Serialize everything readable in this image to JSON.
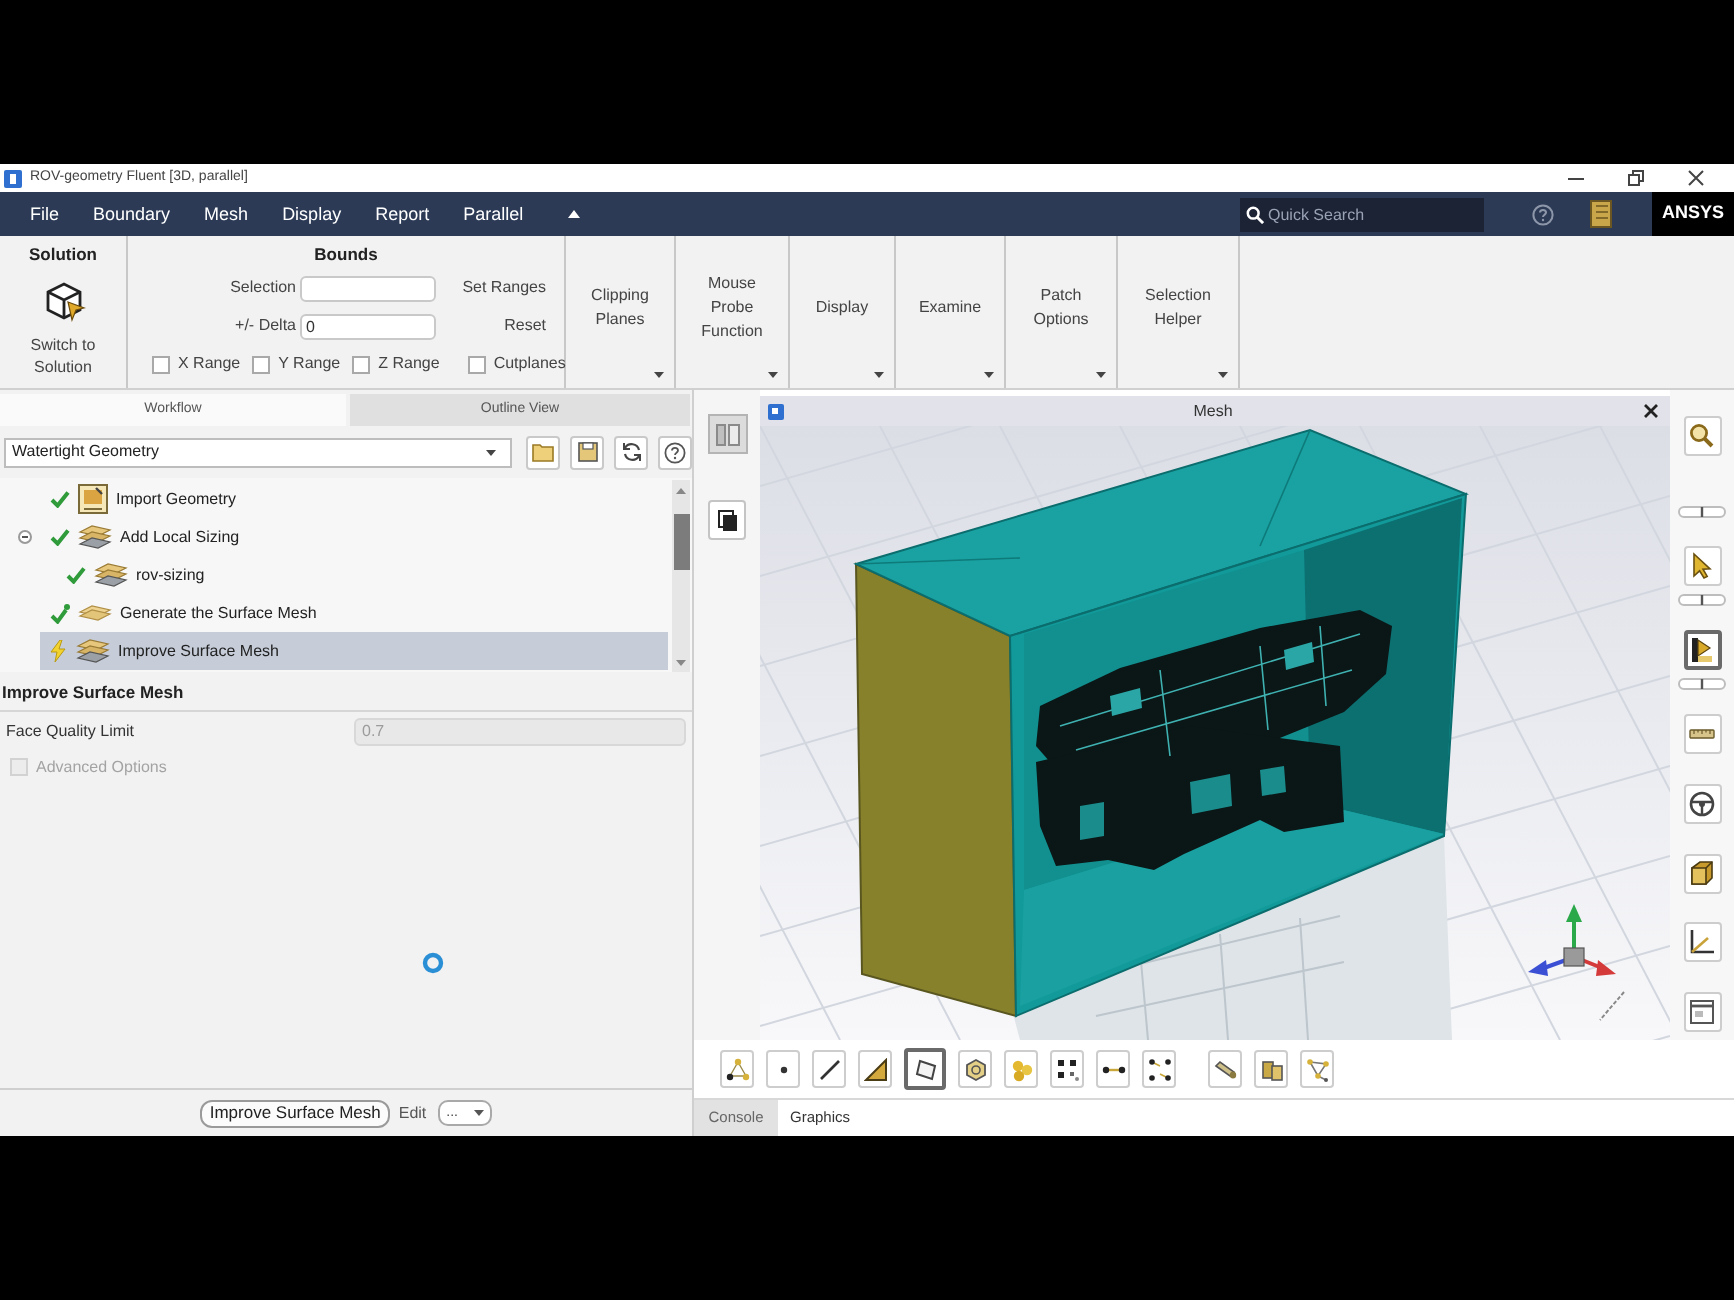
{
  "window": {
    "title": "ROV-geometry Fluent [3D, parallel]"
  },
  "menu_bar": {
    "items": [
      "File",
      "Boundary",
      "Mesh",
      "Display",
      "Report",
      "Parallel"
    ],
    "search": {
      "placeholder": "Quick Search"
    },
    "logo": "ANSYS"
  },
  "ribbon": {
    "solution": {
      "title": "Solution",
      "button": "Switch to Solution"
    },
    "bounds": {
      "title": "Bounds",
      "fields": [
        {
          "label": "Selection"
        },
        {
          "label": "+/- Delta",
          "value": "0"
        }
      ],
      "buttons": [
        "Set Ranges",
        "Reset"
      ],
      "checkboxes": [
        {
          "label": "X Range",
          "checked": false
        },
        {
          "label": "Y Range",
          "checked": false
        },
        {
          "label": "Z Range",
          "checked": false
        },
        {
          "label": "Cutplanes",
          "checked": false
        }
      ]
    },
    "menus": [
      "Clipping Planes",
      "Mouse Probe Function",
      "Display",
      "Examine",
      "Patch Options",
      "Selection Helper"
    ]
  },
  "workflow_panel": {
    "tabs": [
      {
        "label": "Workflow",
        "selected": true
      },
      {
        "label": "Outline View",
        "selected": false
      }
    ],
    "workflow": "Watertight Geometry",
    "tasks": [
      {
        "label": "Import Geometry",
        "kind": "import",
        "complete": true,
        "modified": false,
        "selected": false
      },
      {
        "label": "Add Local Sizing",
        "kind": "sizing",
        "complete": true,
        "modified": false,
        "expanded": true,
        "selected": false,
        "children": [
          {
            "label": "rov-sizing",
            "kind": "sizing",
            "complete": true,
            "modified": false,
            "selected": false
          }
        ]
      },
      {
        "label": "Generate the Surface Mesh",
        "kind": "mesh",
        "complete": true,
        "modified": true,
        "selected": false
      },
      {
        "label": "Improve Surface Mesh",
        "kind": "sizing",
        "complete": false,
        "modified": false,
        "selected": true
      }
    ],
    "task": {
      "title": "Improve Surface Mesh",
      "fields": [
        {
          "label": "Face Quality Limit",
          "value": "0.7",
          "disabled": true
        }
      ],
      "checkboxes": [
        {
          "label": "Advanced Options",
          "checked": false,
          "disabled": true
        }
      ]
    },
    "actions": {
      "run": "Improve Surface Mesh",
      "edit": "Edit",
      "menu": "..."
    }
  },
  "graphics": {
    "title": "Mesh",
    "toolbar": [
      {
        "selected": false
      },
      {
        "selected": false
      },
      {
        "selected": false
      },
      {
        "selected": false
      },
      {
        "selected": true
      },
      {
        "selected": false
      },
      {
        "selected": false
      },
      {
        "selected": false
      },
      {
        "selected": false
      },
      {
        "selected": false
      },
      {
        "selected": false
      },
      {
        "selected": false
      },
      {
        "selected": false
      }
    ],
    "side_toolbar": [
      {
        "selected": false
      },
      {
        "selected": false
      },
      {
        "selected": true
      },
      {
        "selected": false
      },
      {
        "selected": false
      },
      {
        "selected": false
      },
      {
        "selected": false
      },
      {
        "selected": false
      }
    ],
    "tabs": [
      {
        "label": "Console",
        "selected": false
      },
      {
        "label": "Graphics",
        "selected": true
      }
    ]
  }
}
